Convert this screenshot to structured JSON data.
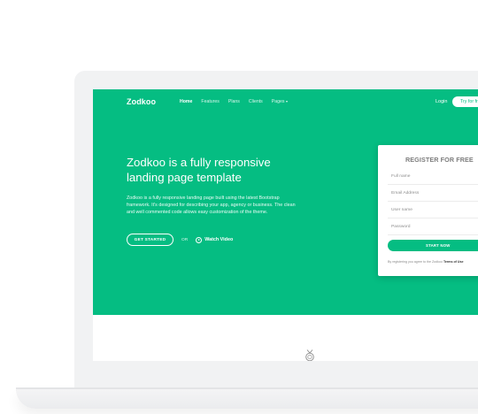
{
  "brand": {
    "logo": "Zodkoo",
    "accent_color": "#05bd82"
  },
  "nav": {
    "items": [
      {
        "label": "Home",
        "active": true
      },
      {
        "label": "Features",
        "active": false
      },
      {
        "label": "Plans",
        "active": false
      },
      {
        "label": "Clients",
        "active": false
      },
      {
        "label": "Pages",
        "active": false,
        "dropdown": true
      }
    ],
    "login_label": "Login",
    "try_label": "Try for free"
  },
  "hero": {
    "headline": "Zodkoo is a fully responsive landing page template",
    "subtext": "Zodkoo is a fully responsive landing page built using the latest Bootstrap framework. It's designed for describing your app, agency or business. The clean and well commented code allows easy customization of the theme.",
    "get_started_label": "GET STARTED",
    "or_label": "OR",
    "watch_label": "Watch Video"
  },
  "register": {
    "title": "REGISTER FOR FREE",
    "fields": [
      {
        "placeholder": "Full name"
      },
      {
        "placeholder": "Email Address"
      },
      {
        "placeholder": "User name"
      },
      {
        "placeholder": "Password"
      }
    ],
    "submit_label": "START NOW",
    "terms_prefix": "By registering you agree to the Zodkoo",
    "terms_link": "Terms of Use"
  }
}
